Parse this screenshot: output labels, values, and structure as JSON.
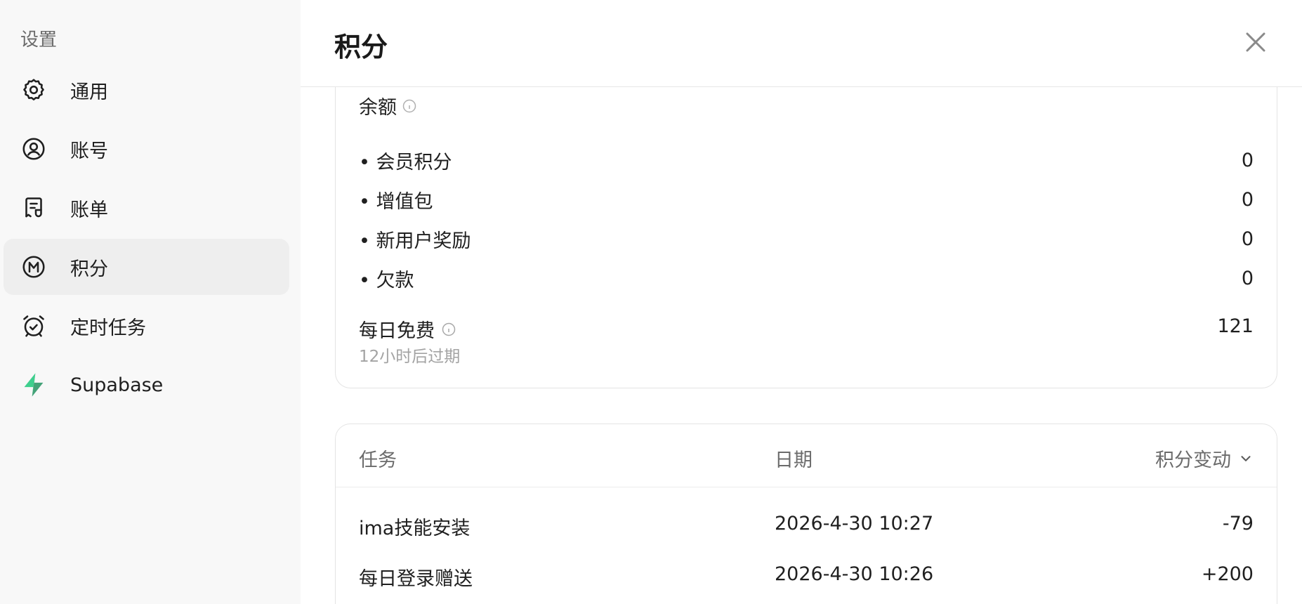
{
  "sidebar": {
    "title": "设置",
    "items": [
      {
        "label": "通用",
        "icon": "gear-icon"
      },
      {
        "label": "账号",
        "icon": "user-circle-icon"
      },
      {
        "label": "账单",
        "icon": "receipt-icon"
      },
      {
        "label": "积分",
        "icon": "points-m-icon",
        "active": true
      },
      {
        "label": "定时任务",
        "icon": "alarm-clock-icon"
      },
      {
        "label": "Supabase",
        "icon": "supabase-logo-icon"
      }
    ]
  },
  "header": {
    "title": "积分",
    "close_icon": "close-icon"
  },
  "balance": {
    "heading": "余额",
    "rows": [
      {
        "name": "会员积分",
        "value": "0"
      },
      {
        "name": "增值包",
        "value": "0"
      },
      {
        "name": "新用户奖励",
        "value": "0"
      },
      {
        "name": "欠款",
        "value": "0"
      }
    ],
    "daily": {
      "label": "每日免费",
      "value": "121",
      "sub": "12小时后过期"
    }
  },
  "history": {
    "columns": {
      "task": "任务",
      "date": "日期",
      "change": "积分变动"
    },
    "rows": [
      {
        "task": "ima技能安装",
        "date": "2026-4-30 10:27",
        "change": "-79"
      },
      {
        "task": "每日登录赠送",
        "date": "2026-4-30 10:26",
        "change": "+200"
      }
    ]
  },
  "colors": {
    "sidebar_bg": "#f8f8f8",
    "active_item_bg": "#eeeeee",
    "supabase_green": "#3ecf8e",
    "muted_text": "#a3a3a3"
  }
}
